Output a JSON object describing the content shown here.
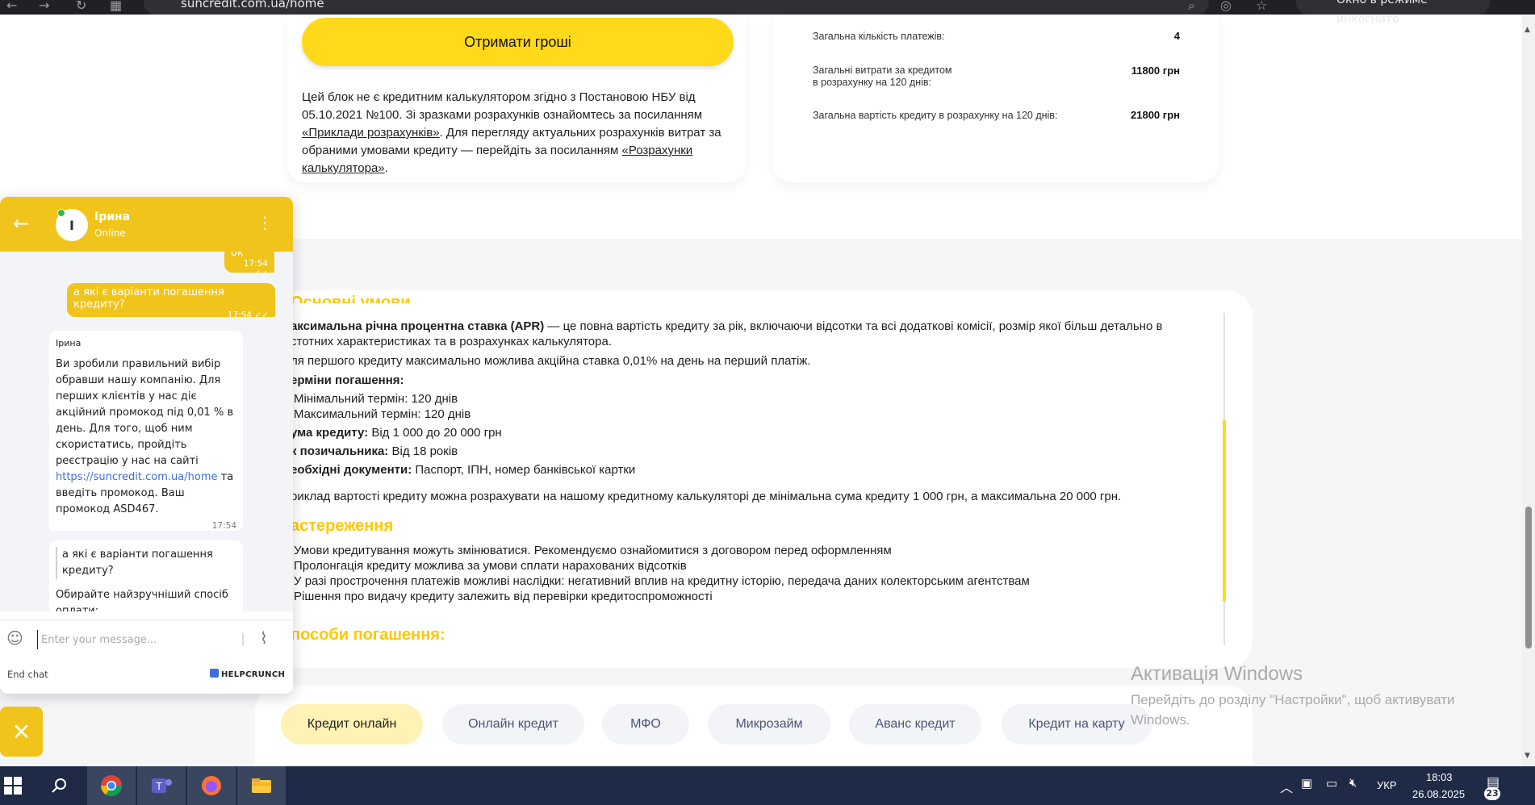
{
  "browser": {
    "url": "suncredit.com.ua/home",
    "incognito_label": "Окно в режиме инкогнито"
  },
  "loan_card": {
    "get_money_button": "Отримати гроші",
    "disclaimer_part1": "Цей блок не є кредитним калькулятором згідно з Постановою НБУ від 05.10.2021 №100. Зі зразками розрахунків ознайомтесь за посиланням",
    "link_examples": "«Приклади розрахунків»",
    "disclaimer_part2": ". Для перегляду актуальних розрахунків витрат за обраними умовами кредиту — перейдіть за посиланням",
    "link_calculator": "«Розрахунки калькулятора»",
    "disclaimer_end": "."
  },
  "summary": {
    "rows": [
      {
        "label": "Загальна кількість платежів:",
        "value": "4"
      },
      {
        "label": "Загальні витрати за кредитом\nв розрахунку на 120 днів:",
        "value": "11800 грн"
      },
      {
        "label": "Загальна вартість кредиту в розрахунку на 120 днів:",
        "value": "21800 грн"
      }
    ]
  },
  "conditions": {
    "heading_partial": "Основні умови",
    "apr_bold": "аксимальна річна процентна ставка (APR)",
    "apr_text": " — це повна вартість кредиту за рік, включаючи відсотки та всі додаткові комісії, розмір якої більш детально в",
    "apr_text2": "стотних характеристиках та в розрахунках калькулятора.",
    "first_loan": "ля першого кредиту максимально можлива акційна ставка 0,01% на день на перший платіж.",
    "terms_bold": "ерміни погашення:",
    "term_min": "Мінімальний термін: 120 днів",
    "term_max": "Максимальний термін: 120 днів",
    "amount_bold": "ума кредиту:",
    "amount_text": " Від 1 000 до 20 000 грн",
    "age_bold": "к позичальника:",
    "age_text": " Від 18 років",
    "docs_bold": "еобхідні документи:",
    "docs_text": " Паспорт, ІПН, номер банківської картки",
    "example": "риклад вартості кредиту можна розрахувати на нашому кредитному калькуляторі де мінімальна сума кредиту 1 000 грн, а максимальна 20 000 грн.",
    "warnings_heading": "астереження",
    "warnings": [
      "Умови кредитування можуть змінюватися. Рекомендуємо ознайомитися з договором перед оформленням",
      "Пролонгація кредиту можлива за умови сплати нарахованих відсотків",
      "У разі прострочення платежів можливі наслідки: негативний вплив на кредитну історію, передача даних колекторським агентствам",
      "Рішення про видачу кредиту залежить від перевірки кредитоспроможності"
    ],
    "repay_heading": "пособи погашення:"
  },
  "tabs": [
    "Кредит онлайн",
    "Онлайн кредит",
    "МФО",
    "Микрозайм",
    "Аванс кредит",
    "Кредит на карту"
  ],
  "watermark": {
    "title": "Активація Windows",
    "subtitle": "Перейдіть до розділу \"Настройки\", щоб активувати Windows."
  },
  "chat": {
    "agent_name": "Ірина",
    "agent_initial": "І",
    "status": "Online",
    "messages": {
      "out1_text": "ок",
      "out1_time": "17:54",
      "out2_text": "а які є варіанти погашення кредиту?",
      "out2_time": "17:54",
      "in1_sender": "Ірина",
      "in1_text_a": "Ви зробили правильний вибір обравши нашу компанію. Для перших клієнтів у нас діє акційний промокод під 0,01 % в день. Для того, щоб ним скористатись, пройдіть реєстрацію у нас на сайті ",
      "in1_link": "https://suncredit.com.ua/home",
      "in1_text_b": " та введіть промокод. Ваш промокод ASD467.",
      "in1_time": "17:54",
      "in2_quote": "а які є варіанти погашення кредиту?",
      "in2_text": "Обирайте найзручніший спосіб оплати:"
    },
    "input_placeholder": "Enter your message...",
    "end_chat": "End chat",
    "brand": "HELPCRUNCH"
  },
  "taskbar": {
    "lang": "УКР",
    "time": "18:03",
    "date": "26.08.2025",
    "notifications": "23"
  },
  "colors": {
    "accent_yellow": "#ffd91a",
    "chat_yellow": "#f1c41c",
    "heading_yellow": "#ffc800",
    "taskbar": "#1f2a47"
  }
}
